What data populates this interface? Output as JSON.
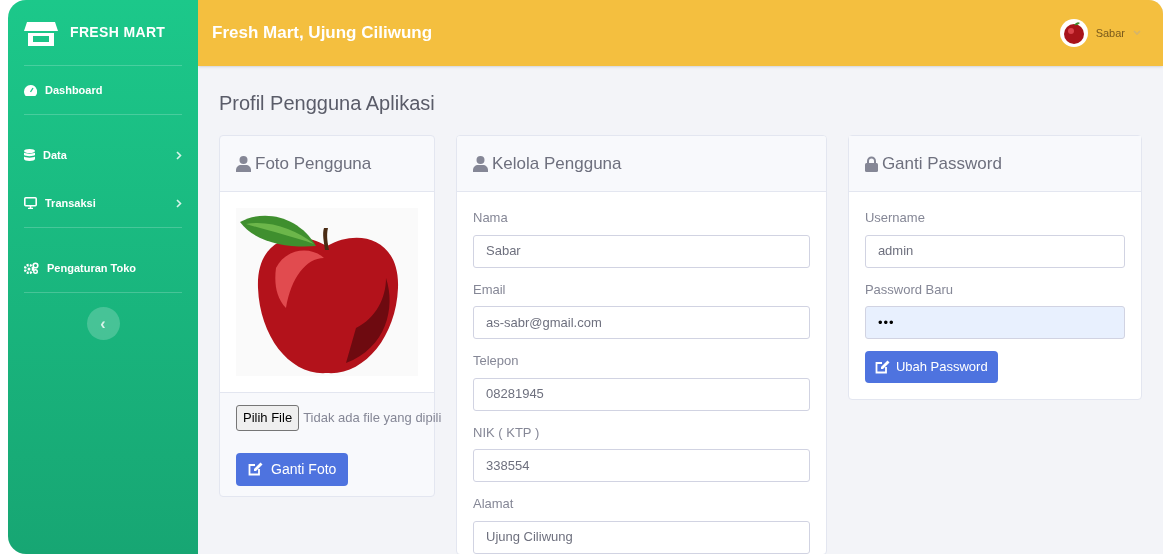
{
  "brand": "FRESH MART",
  "sidebar": {
    "items": [
      {
        "label": "Dashboard",
        "submenu": false
      },
      {
        "label": "Data",
        "submenu": true
      },
      {
        "label": "Transaksi",
        "submenu": true
      },
      {
        "label": "Pengaturan Toko",
        "submenu": false
      }
    ],
    "collapse": "‹"
  },
  "topbar": {
    "title": "Fresh Mart, Ujung Ciliwung",
    "user": "Sabar"
  },
  "page_title": "Profil Pengguna Aplikasi",
  "photo_card": {
    "title": "Foto Pengguna",
    "file_button": "Pilih File",
    "file_status": "Tidak ada file yang dipili",
    "button": "Ganti Foto"
  },
  "user_card": {
    "title": "Kelola Pengguna",
    "fields": [
      {
        "label": "Nama",
        "value": "Sabar",
        "kind": "text"
      },
      {
        "label": "Email",
        "value": "as-sabr@gmail.com",
        "kind": "text"
      },
      {
        "label": "Telepon",
        "value": "08281945",
        "kind": "text"
      },
      {
        "label": "NIK ( KTP )",
        "value": "338554",
        "kind": "text"
      },
      {
        "label": "Alamat",
        "value": "Ujung Ciliwung",
        "kind": "text"
      }
    ]
  },
  "password_card": {
    "title": "Ganti Password",
    "fields": [
      {
        "label": "Username",
        "value": "admin",
        "kind": "text"
      },
      {
        "label": "Password Baru",
        "value": "•••",
        "kind": "password"
      }
    ],
    "button": "Ubah Password"
  }
}
